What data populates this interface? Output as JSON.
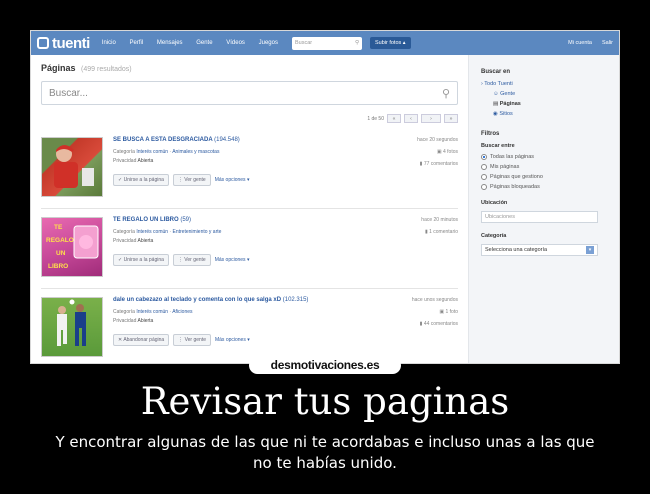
{
  "topbar": {
    "logo": "tuenti",
    "nav": [
      "Inicio",
      "Perfil",
      "Mensajes",
      "Gente",
      "Vídeos",
      "Juegos"
    ],
    "search_placeholder": "Buscar",
    "upload_label": "Subir fotos",
    "right": [
      "Mi cuenta",
      "Salir"
    ]
  },
  "main": {
    "title": "Páginas",
    "result_count": "(499 resultados)",
    "search_placeholder": "Buscar...",
    "pager_info": "1 de 50",
    "results": [
      {
        "title": "SE BUSCA A ESTA DESGRACIADA",
        "members": "(194.548)",
        "category_label": "Categoría",
        "category_type": "Interés común",
        "category_value": "Animales y mascotas",
        "privacy_label": "Privacidad",
        "privacy_value": "Abierta",
        "button1": "Unirse a la página",
        "button2": "Ver gente",
        "more": "Más opciones",
        "time": "hace 20 segundos",
        "stat1": "4 fotos",
        "stat2": "77 comentarios"
      },
      {
        "title": "TE REGALO UN LIBRO",
        "members": "(59)",
        "category_label": "Categoría",
        "category_type": "Interés común",
        "category_value": "Entretenimiento y arte",
        "privacy_label": "Privacidad",
        "privacy_value": "Abierta",
        "button1": "Unirse a la página",
        "button2": "Ver gente",
        "more": "Más opciones",
        "time": "hace 20 minutos",
        "stat1": "1 comentario",
        "stat2": ""
      },
      {
        "title": "dale un cabezazo al teclado y comenta con lo que salga xD",
        "members": "(102.315)",
        "category_label": "Categoría",
        "category_type": "Interés común",
        "category_value": "Aficiones",
        "privacy_label": "Privacidad",
        "privacy_value": "Abierta",
        "button1": "Abandonar página",
        "button2": "Ver gente",
        "more": "Más opciones",
        "time": "hace unos segundos",
        "stat1": "1 foto",
        "stat2": "44 comentarios"
      }
    ]
  },
  "sidebar": {
    "search_in_title": "Buscar en",
    "all_tuenti": "Todo Tuenti",
    "opt_people": "Gente",
    "opt_pages": "Páginas",
    "opt_places": "Sitios",
    "filters_title": "Filtros",
    "search_among": "Buscar entre",
    "radios": [
      "Todas las páginas",
      "Mis páginas",
      "Páginas que gestiono",
      "Páginas bloqueadas"
    ],
    "location_label": "Ubicación",
    "location_placeholder": "Ubicaciones",
    "category_label": "Categoría",
    "category_select": "Selecciona una categoría"
  },
  "watermark": "desmotivaciones.es",
  "caption": {
    "title": "Revisar tus paginas",
    "text": "Y encontrar algunas de las que ni te acordabas e incluso unas a las que no te habías unido."
  }
}
